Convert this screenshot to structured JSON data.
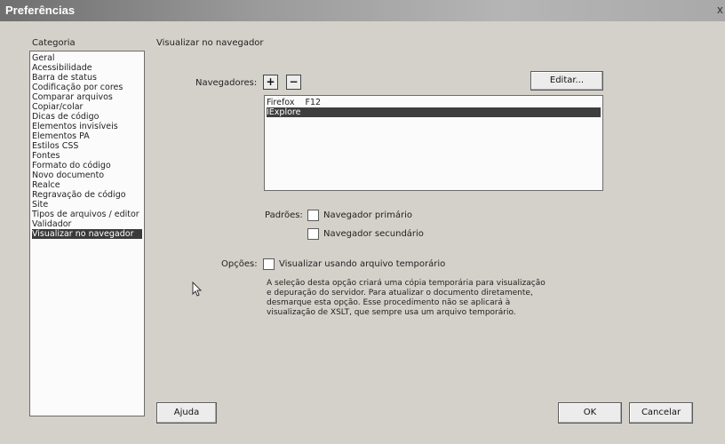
{
  "window": {
    "title": "Preferências",
    "close_glyph": "x"
  },
  "sidebar": {
    "heading": "Categoria",
    "items": [
      {
        "label": "Geral"
      },
      {
        "label": "Acessibilidade"
      },
      {
        "label": "Barra de status"
      },
      {
        "label": "Codificação por cores"
      },
      {
        "label": "Comparar arquivos"
      },
      {
        "label": "Copiar/colar"
      },
      {
        "label": "Dicas de código"
      },
      {
        "label": "Elementos invisíveis"
      },
      {
        "label": "Elementos PA"
      },
      {
        "label": "Estilos CSS"
      },
      {
        "label": "Fontes"
      },
      {
        "label": "Formato do código"
      },
      {
        "label": "Novo documento"
      },
      {
        "label": "Realce"
      },
      {
        "label": "Regravação de código"
      },
      {
        "label": "Site"
      },
      {
        "label": "Tipos de arquivos / editor"
      },
      {
        "label": "Validador"
      },
      {
        "label": "Visualizar no navegador"
      }
    ],
    "selected": "Visualizar no navegador"
  },
  "main": {
    "section_title": "Visualizar no navegador",
    "browsers_label": "Navegadores:",
    "add_glyph": "+",
    "remove_glyph": "−",
    "edit_button": "Editar...",
    "browsers": [
      {
        "label": "Firefox    F12"
      },
      {
        "label": "IExplore"
      }
    ],
    "selected_browser": "IExplore",
    "defaults_label": "Padrões:",
    "primary_label": "Navegador primário",
    "secondary_label": "Navegador secundário",
    "options_label": "Opções:",
    "temp_file_label": "Visualizar usando arquivo temporário",
    "description": "A seleção desta opção criará uma cópia temporária para visualização\ne depuração do servidor. Para atualizar o documento diretamente,\ndesmarque esta opção. Esse procedimento não se aplicará à\nvisualização de XSLT, que sempre usa um arquivo temporário."
  },
  "footer": {
    "help_button": "Ajuda",
    "ok_button": "OK",
    "cancel_button": "Cancelar"
  },
  "colors": {
    "selection": "#3a3a3a",
    "background": "#d4d1ca"
  }
}
